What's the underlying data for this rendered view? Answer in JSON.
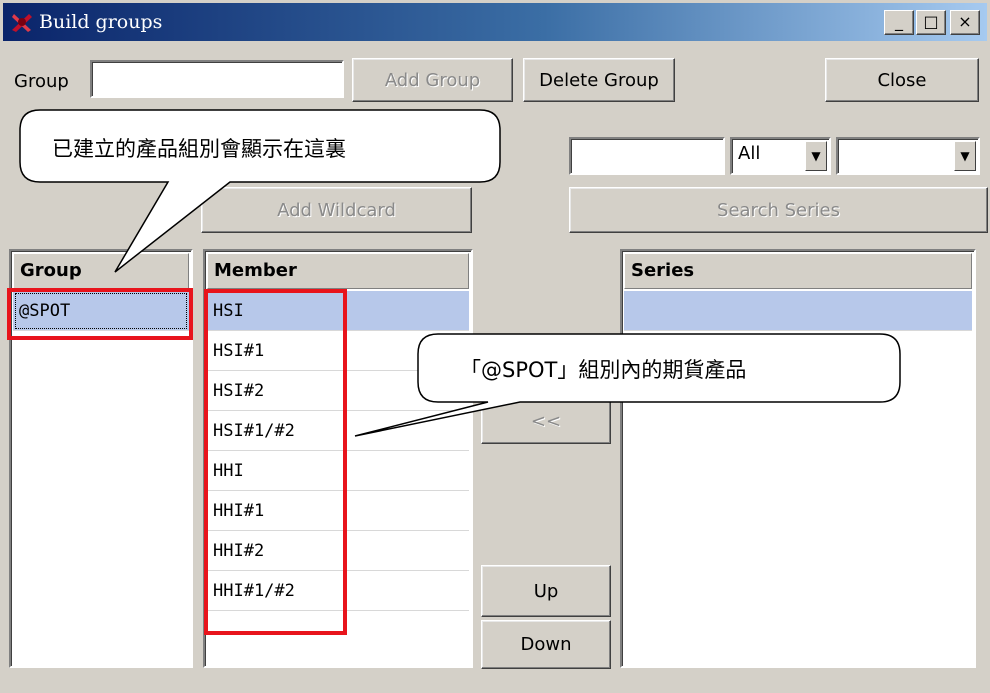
{
  "window": {
    "title": "Build groups",
    "minimize_glyph": "_",
    "maximize_glyph": "□",
    "close_glyph": "×"
  },
  "top_row": {
    "group_label": "Group",
    "group_input_value": "",
    "add_group_label": "Add Group",
    "delete_group_label": "Delete Group",
    "close_label": "Close"
  },
  "search": {
    "text_value": "",
    "type_selected": "All",
    "extra_selected": "",
    "add_wildcard_label": "Add Wildcard",
    "search_series_label": "Search Series"
  },
  "group_list": {
    "header": "Group",
    "items": [
      "@SPOT"
    ]
  },
  "member_list": {
    "header": "Member",
    "items": [
      "HSI",
      "HSI#1",
      "HSI#2",
      "HSI#1/#2",
      "HHI",
      "HHI#1",
      "HHI#2",
      "HHI#1/#2"
    ]
  },
  "series_list": {
    "header": "Series",
    "items": [
      ""
    ]
  },
  "middle_buttons": {
    "remove_label": "<<",
    "up_label": "Up",
    "down_label": "Down"
  },
  "callouts": {
    "group_note": "已建立的產品組別會顯示在這裏",
    "member_note": "「@SPOT」組別內的期貨產品"
  },
  "colors": {
    "window_bg": "#d4d0c8",
    "selection": "#b7c8ea",
    "highlight_box": "#e8141c",
    "title_gradient_start": "#0a246a"
  }
}
